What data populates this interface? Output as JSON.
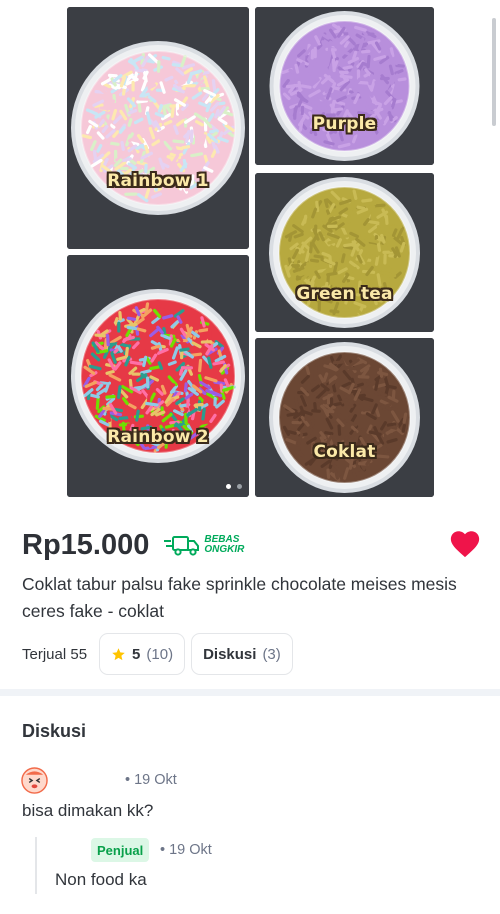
{
  "gallery": {
    "photos": [
      {
        "label": "Rainbow 1",
        "colors": [
          "#f6c8d8",
          "#c8e6f5",
          "#fde9b0",
          "#d9f0c8",
          "#e5d2f2",
          "#ffffff"
        ]
      },
      {
        "label": "Purple",
        "colors": [
          "#b88fdc",
          "#c9a2e6",
          "#a67ccf"
        ]
      },
      {
        "label": "Green tea",
        "colors": [
          "#b7a93f",
          "#c9bb55",
          "#a39535"
        ]
      },
      {
        "label": "Rainbow 2",
        "colors": [
          "#e63946",
          "#f4a261",
          "#2a9d8f",
          "#e9c46a",
          "#8ecae6",
          "#ff70a6",
          "#70e000",
          "#9b5de5"
        ]
      },
      {
        "label": "Coklat",
        "colors": [
          "#6b4734",
          "#7d5640",
          "#5a3a2a"
        ]
      }
    ]
  },
  "product": {
    "price": "Rp15.000",
    "free_shipping_line1": "BEBAS",
    "free_shipping_line2": "ONGKIR",
    "title": "Coklat tabur palsu fake sprinkle chocolate meises mesis ceres fake - coklat",
    "sold": "Terjual 55",
    "rating": "5",
    "rating_count": "(10)",
    "discussion_label": "Diskusi",
    "discussion_count": "(3)"
  },
  "discussion": {
    "title": "Diskusi",
    "question": {
      "date": "• 19 Okt",
      "text": "bisa dimakan kk?"
    },
    "reply": {
      "badge": "Penjual",
      "date": "• 19 Okt",
      "text": "Non food ka"
    }
  },
  "colors": {
    "accent": "#00aa5b",
    "heart": "#ef144a",
    "star": "#ffc400"
  }
}
